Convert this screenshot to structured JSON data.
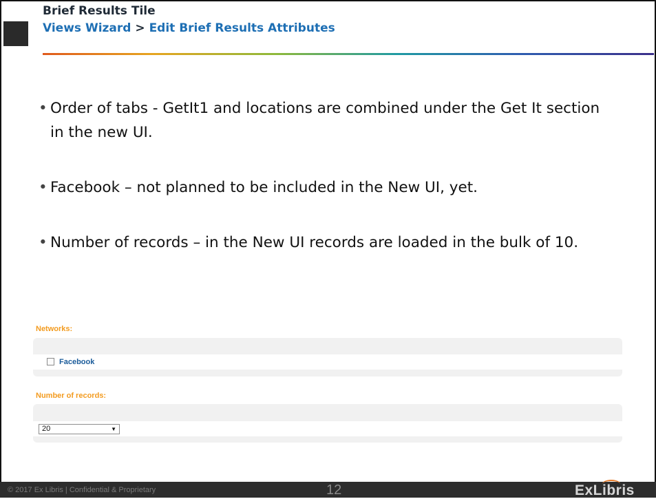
{
  "header": {
    "title": "Brief Results Tile",
    "breadcrumb": {
      "first": "Views Wizard",
      "separator": ">",
      "second": "Edit Brief Results Attributes"
    }
  },
  "bullets": [
    "Order of tabs - GetIt1 and locations are combined under the Get It section in the new UI.",
    "Facebook – not planned to be included in the New UI, yet.",
    "Number of records – in the New UI records are loaded in the bulk of 10."
  ],
  "form": {
    "networks": {
      "label": "Networks:",
      "option_label": "Facebook",
      "checked": false
    },
    "records": {
      "label": "Number of records:",
      "selected_value": "20"
    }
  },
  "footer": {
    "copyright": "© 2017 Ex Libris | Confidential & Proprietary",
    "page_number": "12",
    "logo_text": "ExLibris"
  },
  "colors": {
    "link": "#1e6fb4",
    "form_label": "#f39b1f",
    "footer_bg": "#2d2d2d"
  }
}
